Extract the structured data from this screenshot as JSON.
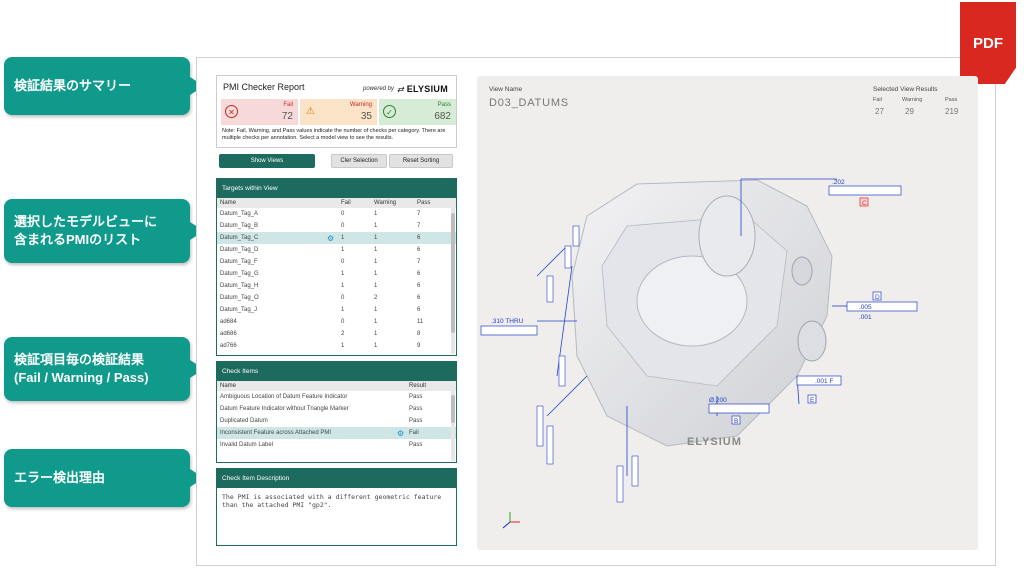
{
  "callouts": {
    "summary": "検証結果のサマリー",
    "pmi_list": "選択したモデルビューに\n含まれるPMIのリスト",
    "check_results": "検証項目毎の検証結果\n(Fail / Warning / Pass)",
    "error_reason": "エラー検出理由"
  },
  "pdf_badge": "PDF",
  "report": {
    "title": "PMI Checker Report",
    "powered_by": "powered by",
    "brand": "ELYSIUM",
    "fail_label": "Fail",
    "fail_value": "72",
    "warning_label": "Warning",
    "warning_value": "35",
    "pass_label": "Pass",
    "pass_value": "682",
    "note": "Note: Fail, Warning, and Pass values indicate the number of checks per category. There are multiple checks per annotation. Select a model view to see the results."
  },
  "buttons": {
    "show_views": "Show Views",
    "clear_selection": "Cler Selection",
    "reset_sorting": "Reset Sorting"
  },
  "targets": {
    "title": "Targets within View",
    "columns": [
      "Name",
      "Fail",
      "Warning",
      "Pass"
    ],
    "rows": [
      {
        "name": "Datum_Tag_A",
        "fail": "0",
        "warning": "1",
        "pass": "7"
      },
      {
        "name": "Datum_Tag_B",
        "fail": "0",
        "warning": "1",
        "pass": "7"
      },
      {
        "name": "Datum_Tag_C",
        "fail": "1",
        "warning": "1",
        "pass": "6"
      },
      {
        "name": "Datum_Tag_D",
        "fail": "1",
        "warning": "1",
        "pass": "6"
      },
      {
        "name": "Datum_Tag_F",
        "fail": "0",
        "warning": "1",
        "pass": "7"
      },
      {
        "name": "Datum_Tag_G",
        "fail": "1",
        "warning": "1",
        "pass": "6"
      },
      {
        "name": "Datum_Tag_H",
        "fail": "1",
        "warning": "1",
        "pass": "6"
      },
      {
        "name": "Datum_Tag_O",
        "fail": "0",
        "warning": "2",
        "pass": "6"
      },
      {
        "name": "Datum_Tag_J",
        "fail": "1",
        "warning": "1",
        "pass": "6"
      },
      {
        "name": "ad684",
        "fail": "0",
        "warning": "1",
        "pass": "11"
      },
      {
        "name": "ad686",
        "fail": "2",
        "warning": "1",
        "pass": "8"
      },
      {
        "name": "ad766",
        "fail": "1",
        "warning": "1",
        "pass": "9"
      }
    ]
  },
  "checks": {
    "title": "Check Items",
    "columns": [
      "Name",
      "Result"
    ],
    "rows": [
      {
        "name": "Ambiguous Location of Datum Feature Indicator",
        "result": "Pass"
      },
      {
        "name": "Datum Feature Indicator without Triangle Marker",
        "result": "Pass"
      },
      {
        "name": "Duplicated Datum",
        "result": "Pass"
      },
      {
        "name": "Inconsistent Feature across Attached PMI",
        "result": "Fail"
      },
      {
        "name": "Invalid Datum Label",
        "result": "Pass"
      }
    ]
  },
  "description": {
    "title": "Check Item Description",
    "text": "The PMI is associated with a different geometric feature than the attached PMI \"gp2\"."
  },
  "viewer": {
    "view_name_label": "View Name",
    "view_name": "D03_DATUMS",
    "selected_label": "Selected View Results",
    "fail_label": "Fail",
    "warning_label": "Warning",
    "pass_label": "Pass",
    "fail_value": "27",
    "warning_value": "29",
    "pass_value": "219",
    "watermark": "ELYSIUM",
    "annotations": {
      "a202": ".202",
      "a310": ".310 THRU",
      "a200": "Ø.200",
      "a005": ".005",
      "a001": ".001",
      "a001b": ".001 F",
      "datum_c": "C",
      "datum_d": "D",
      "datum_b": "B",
      "datum_e": "E"
    }
  },
  "colors": {
    "teal": "#0f9a8c",
    "dark_teal": "#1d6b5e",
    "pdf_red": "#d9281f",
    "fail_bg": "#f8d9d9",
    "warn_bg": "#fbe3c8",
    "pass_bg": "#d6ecd6"
  }
}
